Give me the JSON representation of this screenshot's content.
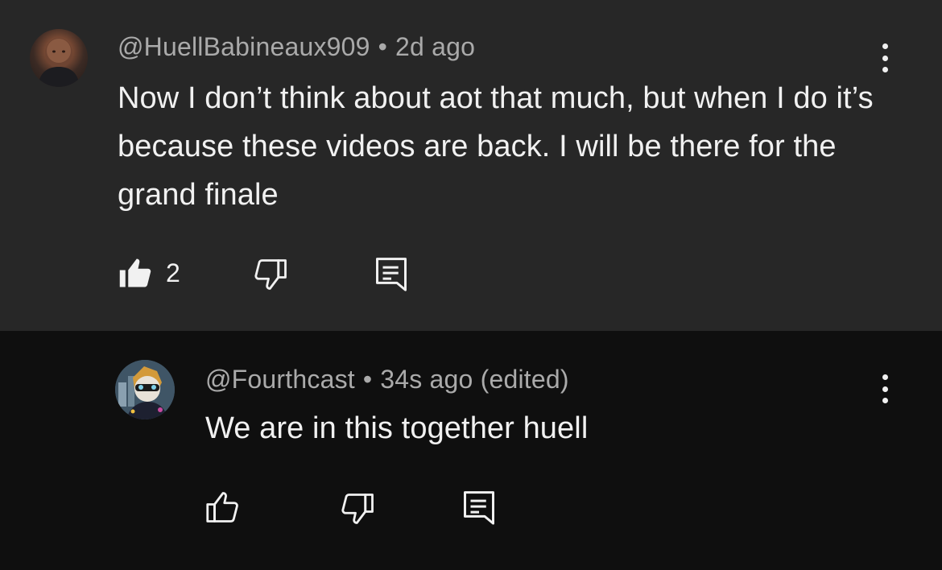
{
  "comments": [
    {
      "author": "@HuellBabineaux909",
      "separator": "•",
      "time": "2d ago",
      "text": "Now I don’t think about aot that much, but when I do it’s because these videos are back. I will be there for the grand finale",
      "likes": "2",
      "liked": true,
      "icons": {
        "like": "thumbs-up-filled-icon",
        "dislike": "thumbs-down-icon",
        "reply": "reply-comment-icon",
        "menu": "kebab-menu-icon"
      }
    },
    {
      "author": "@Fourthcast",
      "separator": "•",
      "time": "34s ago (edited)",
      "text": "We are in this together huell",
      "likes": "",
      "liked": false,
      "icons": {
        "like": "thumbs-up-outline-icon",
        "dislike": "thumbs-down-icon",
        "reply": "reply-comment-icon",
        "menu": "kebab-menu-icon"
      }
    }
  ],
  "colors": {
    "parent_bg": "#272727",
    "reply_bg": "#0f0f0f",
    "primary_text": "#f1f1f1",
    "secondary_text": "#aaaaaa"
  }
}
